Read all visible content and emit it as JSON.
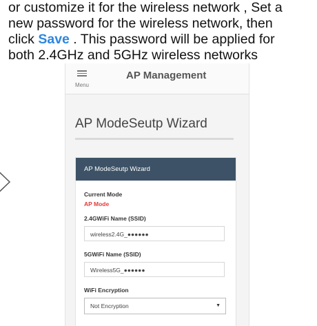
{
  "instructions": {
    "line1": "or customize it for the wireless network , Set a",
    "line2": "new password for the wireless network, then",
    "line3_prefix": "click ",
    "line3_save": "Save",
    "line3_suffix": " . This password will be applied for",
    "line4": "both 2.4GHz and 5GHz wireless networks"
  },
  "app_bar": {
    "menu_icon": "hamburger-menu-icon",
    "menu_label": "Menu",
    "title": "AP Management"
  },
  "page": {
    "title": "AP ModeSeutp Wizard"
  },
  "card": {
    "header": "AP ModeSeutp Wizard",
    "current_mode_label": "Current Mode",
    "current_mode_value": "AP Mode",
    "ssid24_label": "2.4GWiFi Name (SSID)",
    "ssid24_value": "wireless2.4G_●●●●●●",
    "ssid5_label": "5GWiFi Name (SSID)",
    "ssid5_value": "Wireless5G_●●●●●●",
    "encryption_label": "WiFi Encryption",
    "encryption_value": "Not Encryption"
  },
  "colors": {
    "accent": "#2e86de",
    "card_header": "#3d5266",
    "mode_value": "#e23a3a"
  }
}
